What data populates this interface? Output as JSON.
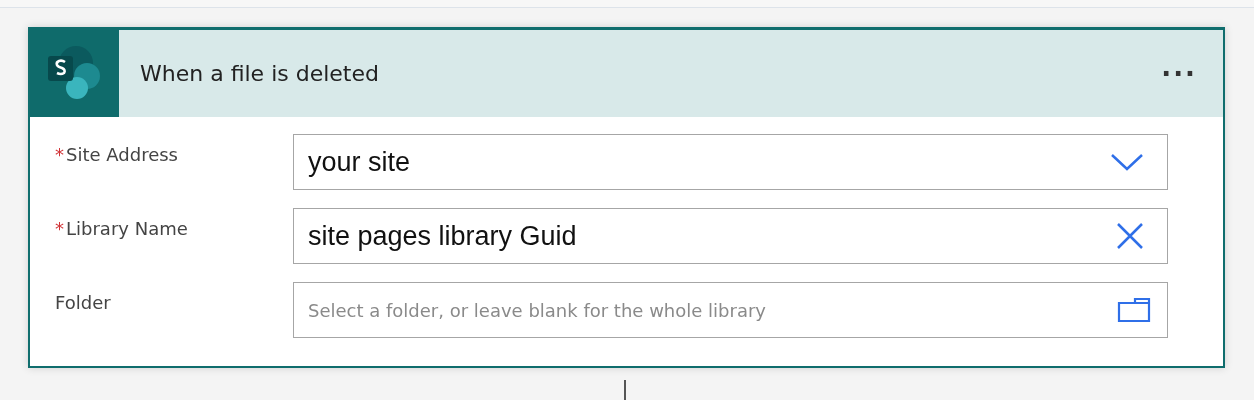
{
  "card": {
    "title": "When a file is deleted",
    "menu": "···",
    "fields": [
      {
        "kind": "dropdown",
        "required_mark": "*",
        "label": "Site Address",
        "value": "your site"
      },
      {
        "kind": "clearable",
        "required_mark": "*",
        "label": "Library Name",
        "value": "site pages library Guid"
      },
      {
        "kind": "folder",
        "label": "Folder",
        "placeholder": "Select a folder, or leave blank for the whole library"
      }
    ]
  }
}
